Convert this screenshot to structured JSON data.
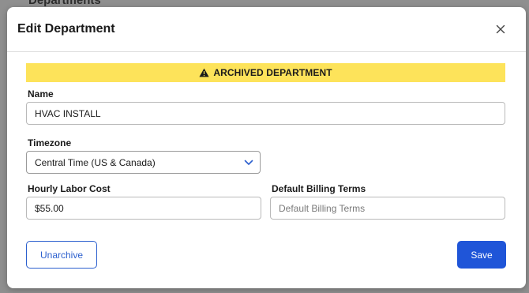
{
  "backdrop": {
    "title": "Departments"
  },
  "modal": {
    "title": "Edit Department",
    "banner": "ARCHIVED DEPARTMENT",
    "fields": {
      "name": {
        "label": "Name",
        "value": "HVAC INSTALL"
      },
      "timezone": {
        "label": "Timezone",
        "value": "Central Time (US & Canada)"
      },
      "hourly_labor_cost": {
        "label": "Hourly Labor Cost",
        "value": "$55.00"
      },
      "default_billing_terms": {
        "label": "Default Billing Terms",
        "value": "",
        "placeholder": "Default Billing Terms"
      }
    },
    "buttons": {
      "unarchive": "Unarchive",
      "save": "Save"
    }
  },
  "colors": {
    "banner": "#fde35a",
    "primary": "#1f55d8",
    "outline": "#2b5fce"
  },
  "icons": [
    "close-icon",
    "warning-icon",
    "chevron-down-icon"
  ]
}
